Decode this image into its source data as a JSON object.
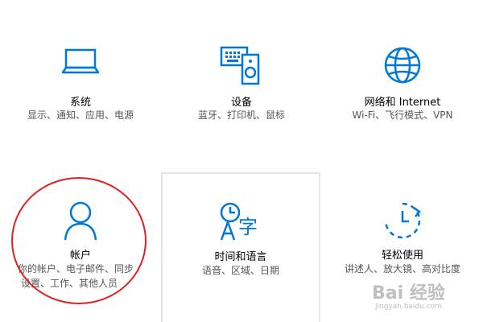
{
  "colors": {
    "accent": "#0078d7",
    "annotation": "#e02020"
  },
  "tiles": [
    {
      "id": "system",
      "icon": "laptop-icon",
      "title": "系统",
      "desc_lines": [
        "显示、通知、应用、电源"
      ]
    },
    {
      "id": "devices",
      "icon": "devices-icon",
      "title": "设备",
      "desc_lines": [
        "蓝牙、打印机、鼠标"
      ]
    },
    {
      "id": "network",
      "icon": "globe-icon",
      "title": "网络和 Internet",
      "desc_lines": [
        "Wi-Fi、飞行模式、VPN"
      ]
    },
    {
      "id": "accounts",
      "icon": "person-icon",
      "title": "帐户",
      "desc_lines": [
        "你的帐户、电子邮件、同步",
        "设置、工作、其他人员"
      ]
    },
    {
      "id": "time",
      "icon": "time-language-icon",
      "title": "时间和语言",
      "desc_lines": [
        "语音、区域、日期"
      ]
    },
    {
      "id": "ease",
      "icon": "ease-of-access-icon",
      "title": "轻松使用",
      "desc_lines": [
        "讲述人、放大镜、高对比度"
      ]
    }
  ],
  "watermark": {
    "main": "Bai 经验",
    "sub": "jingyan.baidu.com"
  }
}
